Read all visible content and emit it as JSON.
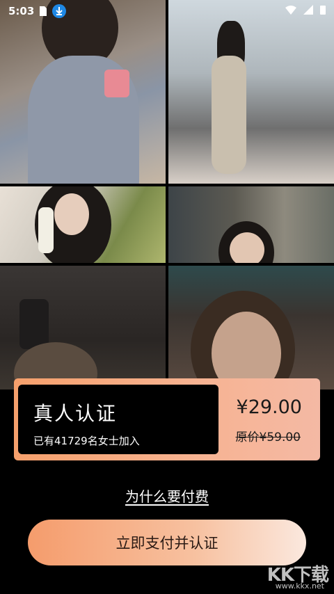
{
  "status_bar": {
    "time": "5:03"
  },
  "banner": {
    "title": "真人认证",
    "subtitle": "已有41729名女士加入",
    "price": "¥29.00",
    "original_price": "原价¥59.00"
  },
  "why_link": "为什么要付费",
  "pay_button": "立即支付并认证",
  "watermark": {
    "logo": "KK下载",
    "url": "www.kkx.net"
  },
  "colors": {
    "accent_start": "#f59c6c",
    "accent_end": "#fbe8de",
    "background": "#000000"
  }
}
